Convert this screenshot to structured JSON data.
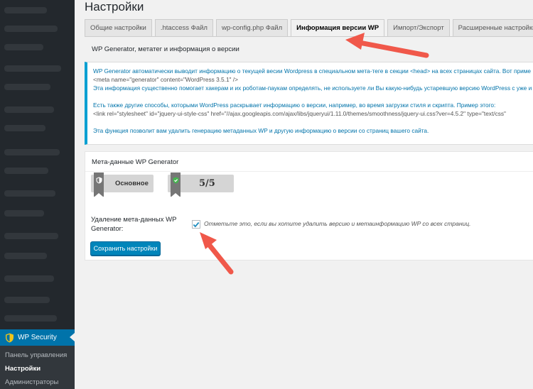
{
  "page": {
    "title": "Настройки"
  },
  "sidebar": {
    "plugin": "WP Security",
    "submenu": [
      "Панель управления",
      "Настройки",
      "Администраторы"
    ]
  },
  "tabs": [
    {
      "label": "Общие настройки",
      "active": false
    },
    {
      "label": ".htaccess Файл",
      "active": false
    },
    {
      "label": "wp-config.php Файл",
      "active": false
    },
    {
      "label": "Информация версии WP",
      "active": true
    },
    {
      "label": "Импорт/Экспорт",
      "active": false
    },
    {
      "label": "Расширенные настройки",
      "active": false
    }
  ],
  "section": {
    "title": "WP Generator, метатег и информация о версии"
  },
  "info": {
    "line1": "WP Generator автоматически выводит информацию о текущей весии Wordpress в специальном мета-теге в секции <head> на всех страницах сайта. Вот приме",
    "line2": "<meta name=\"generator\" content=\"WordPress 3.5.1\" />",
    "line3": "Эта информация существенно помогает хакерам и их роботам-паукам определять, не используете ли Вы какую-нибудь устаревшую версию WordPress с уже и",
    "line4": "Есть также другие способы, которыми WordPress раскрывает информацию о версии, например, во время загрузки стиля и скрипта. Пример этого:",
    "line5": "<link rel=\"stylesheet\" id=\"jquery-ui-style-css\" href=\"//ajax.googleapis.com/ajax/libs/jqueryui/1.11.0/themes/smoothness/jquery-ui.css?ver=4.5.2\" type=\"text/css\"",
    "line6": "Эта функция позволит вам удалить генерацию метаданных WP и другую информацию о версии со страниц вашего сайта."
  },
  "panel": {
    "title": "Мета-данные WP Generator",
    "badge_label": "Основное",
    "badge_score": "5/5",
    "field_label": "Удаление мета-данных WP Generator:",
    "checkbox_checked": true,
    "checkbox_desc": "Отметьте это, если вы хотите удалить версию и метаинформацию WP со всех страниц.",
    "save_label": "Сохранить настройки"
  },
  "colors": {
    "accent": "#0073aa",
    "button": "#0085ba",
    "arrow": "#f0584a",
    "sidebar": "#23282d"
  }
}
